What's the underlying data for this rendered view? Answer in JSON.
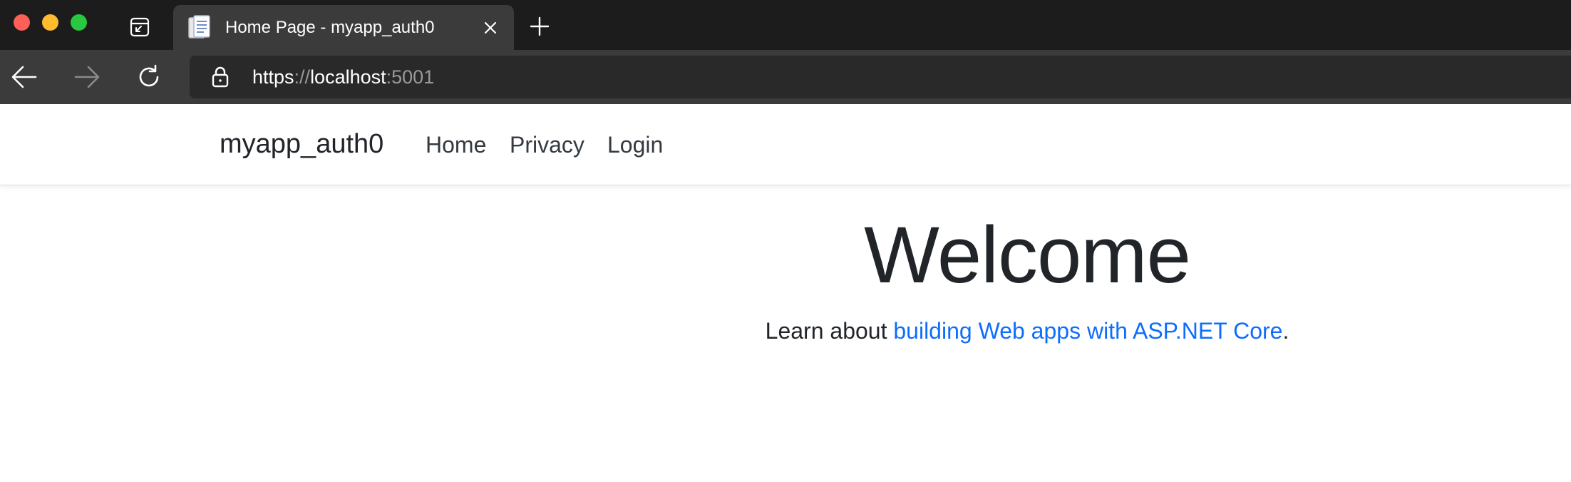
{
  "browser": {
    "tab": {
      "title": "Home Page - myapp_auth0"
    },
    "address": {
      "scheme": "https",
      "separator": "://",
      "host": "localhost",
      "port": ":5001"
    },
    "icons": {
      "tab_actions": "tab-actions-icon",
      "favicon": "page-favicon-icon",
      "close": "close-icon",
      "new_tab": "plus-icon",
      "back": "arrow-left-icon",
      "forward": "arrow-right-icon",
      "reload": "reload-icon",
      "lock": "lock-icon"
    },
    "colors": {
      "titlebar": "#1c1c1c",
      "toolbar": "#3b3b3b",
      "addressbar": "#292929",
      "close": "#fe5f57",
      "minimize": "#febc2e",
      "maximize": "#28c840"
    }
  },
  "site": {
    "brand": "myapp_auth0",
    "nav": [
      {
        "label": "Home"
      },
      {
        "label": "Privacy"
      },
      {
        "label": "Login"
      }
    ]
  },
  "main": {
    "heading": "Welcome",
    "lead_prefix": "Learn about ",
    "lead_link": "building Web apps with ASP.NET Core",
    "lead_suffix": ".",
    "link_color": "#0d6efd"
  }
}
